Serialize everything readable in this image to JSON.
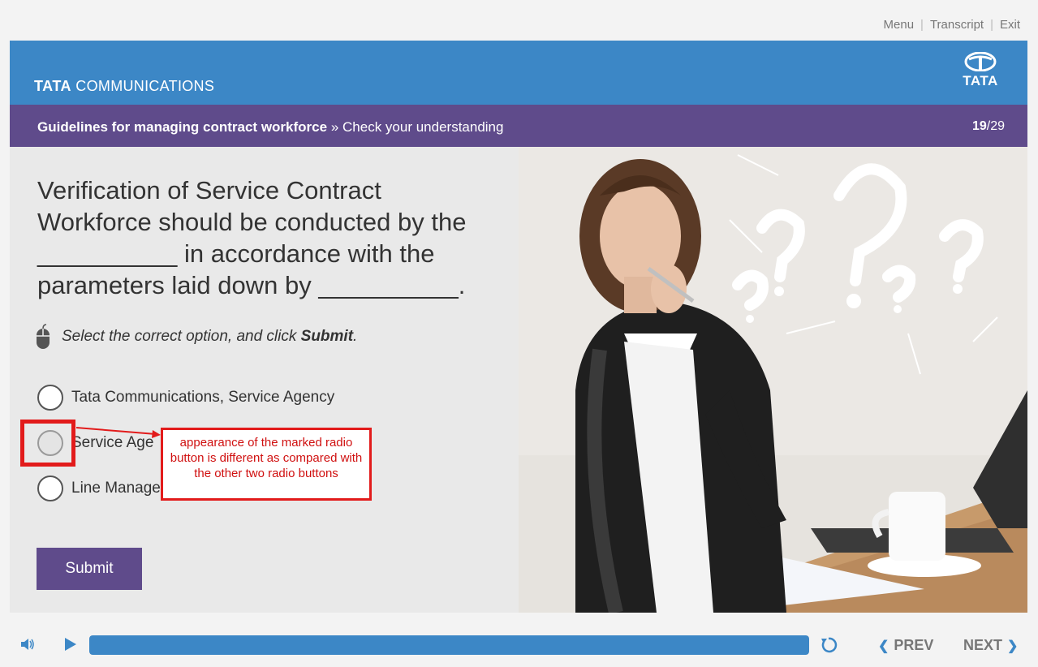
{
  "top_nav": {
    "menu": "Menu",
    "transcript": "Transcript",
    "exit": "Exit",
    "separator": "|"
  },
  "header": {
    "brand_bold": "TATA",
    "brand_rest": "COMMUNICATIONS",
    "logo_text": "TATA",
    "color": "#3c87c6"
  },
  "breadcrumb": {
    "course": "Guidelines for managing contract workforce",
    "separator": "»",
    "section": "Check your understanding"
  },
  "pager": {
    "current": "19",
    "total": "/29"
  },
  "question": {
    "line1": "Verification of Service Contract",
    "line2": "Workforce should be conducted by the",
    "line3": "__________ in accordance with the",
    "line4": "parameters laid down by __________."
  },
  "instruction": {
    "text": "Select the correct option, and click",
    "emphasis": "Submit",
    "end": ".",
    "icon": "mouse-icon"
  },
  "options": [
    {
      "label": "Tata Communications, Service Agency"
    },
    {
      "label": "Service Age"
    },
    {
      "label": "Line Manage"
    }
  ],
  "annotation": {
    "text": "appearance of the marked radio button is different as compared with the other two radio buttons",
    "color": "#e21b1b"
  },
  "submit_label": "Submit",
  "footer": {
    "prev_label": "PREV",
    "next_label": "NEXT",
    "progress_fraction": 1.0,
    "accent": "#3c87c6"
  },
  "colors": {
    "purple": "#5f4b8b",
    "blue": "#3c87c6",
    "annotation_red": "#e21b1b"
  }
}
